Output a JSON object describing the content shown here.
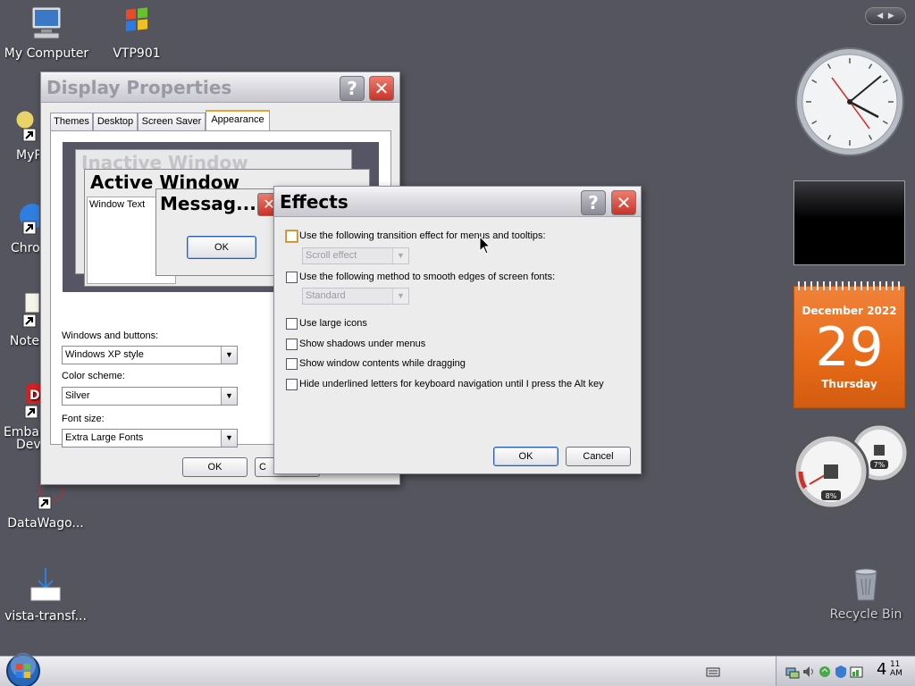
{
  "desktop": {
    "icons": [
      {
        "label": "My Computer",
        "icon": "computer-icon"
      },
      {
        "label": "VTP901",
        "icon": "windows-flag-icon"
      },
      {
        "label": "MyP",
        "icon": "shortcut-icon"
      },
      {
        "label": "Chro",
        "icon": "chrome-icon"
      },
      {
        "label": "Note",
        "icon": "notepad-icon"
      },
      {
        "label": "Emba",
        "label2": "Dev",
        "icon": "embarcadero-icon"
      },
      {
        "label": "DataWago...",
        "icon": "datawagon-icon"
      },
      {
        "label": "vista-transf...",
        "icon": "download-icon"
      },
      {
        "label": "Recycle Bin",
        "icon": "recycle-bin-icon"
      }
    ]
  },
  "display_properties": {
    "title": "Display Properties",
    "tabs": [
      "Themes",
      "Desktop",
      "Screen Saver",
      "Appearance"
    ],
    "active_tab": "Appearance",
    "preview": {
      "inactive_window": "Inactive Window",
      "active_window": "Active Window",
      "window_text": "Window Text",
      "message_box": "Messag...",
      "ok": "OK"
    },
    "windows_and_buttons_label": "Windows and buttons:",
    "windows_and_buttons_value": "Windows XP style",
    "color_scheme_label": "Color scheme:",
    "color_scheme_value": "Silver",
    "font_size_label": "Font size:",
    "font_size_value": "Extra Large Fonts",
    "ok": "OK",
    "cancel_partial": "C"
  },
  "effects": {
    "title": "Effects",
    "options": [
      {
        "label": "Use the following transition effect for menus and tooltips:",
        "checked": false
      },
      {
        "label": "Use the following method to smooth edges of screen fonts:",
        "checked": false
      },
      {
        "label": "Use large icons",
        "checked": false
      },
      {
        "label": "Show shadows under menus",
        "checked": false
      },
      {
        "label": "Show window contents while dragging",
        "checked": false
      },
      {
        "label": "Hide underlined letters for keyboard navigation until I press the Alt key",
        "checked": false
      }
    ],
    "transition_value": "Scroll effect",
    "smoothing_value": "Standard",
    "ok": "OK",
    "cancel": "Cancel"
  },
  "gadgets": {
    "calendar": {
      "month_year": "December 2022",
      "day": "29",
      "weekday": "Thursday"
    },
    "meter": {
      "cpu": "8%",
      "memory": "7%"
    }
  },
  "taskbar": {
    "clock_hour": "4",
    "clock_minute": "11",
    "clock_ampm": "AM"
  },
  "colors": {
    "desktop": "#55555f",
    "calendar": "#e86a17",
    "close_button": "#c8332a",
    "focus_accent": "#e8a432"
  }
}
